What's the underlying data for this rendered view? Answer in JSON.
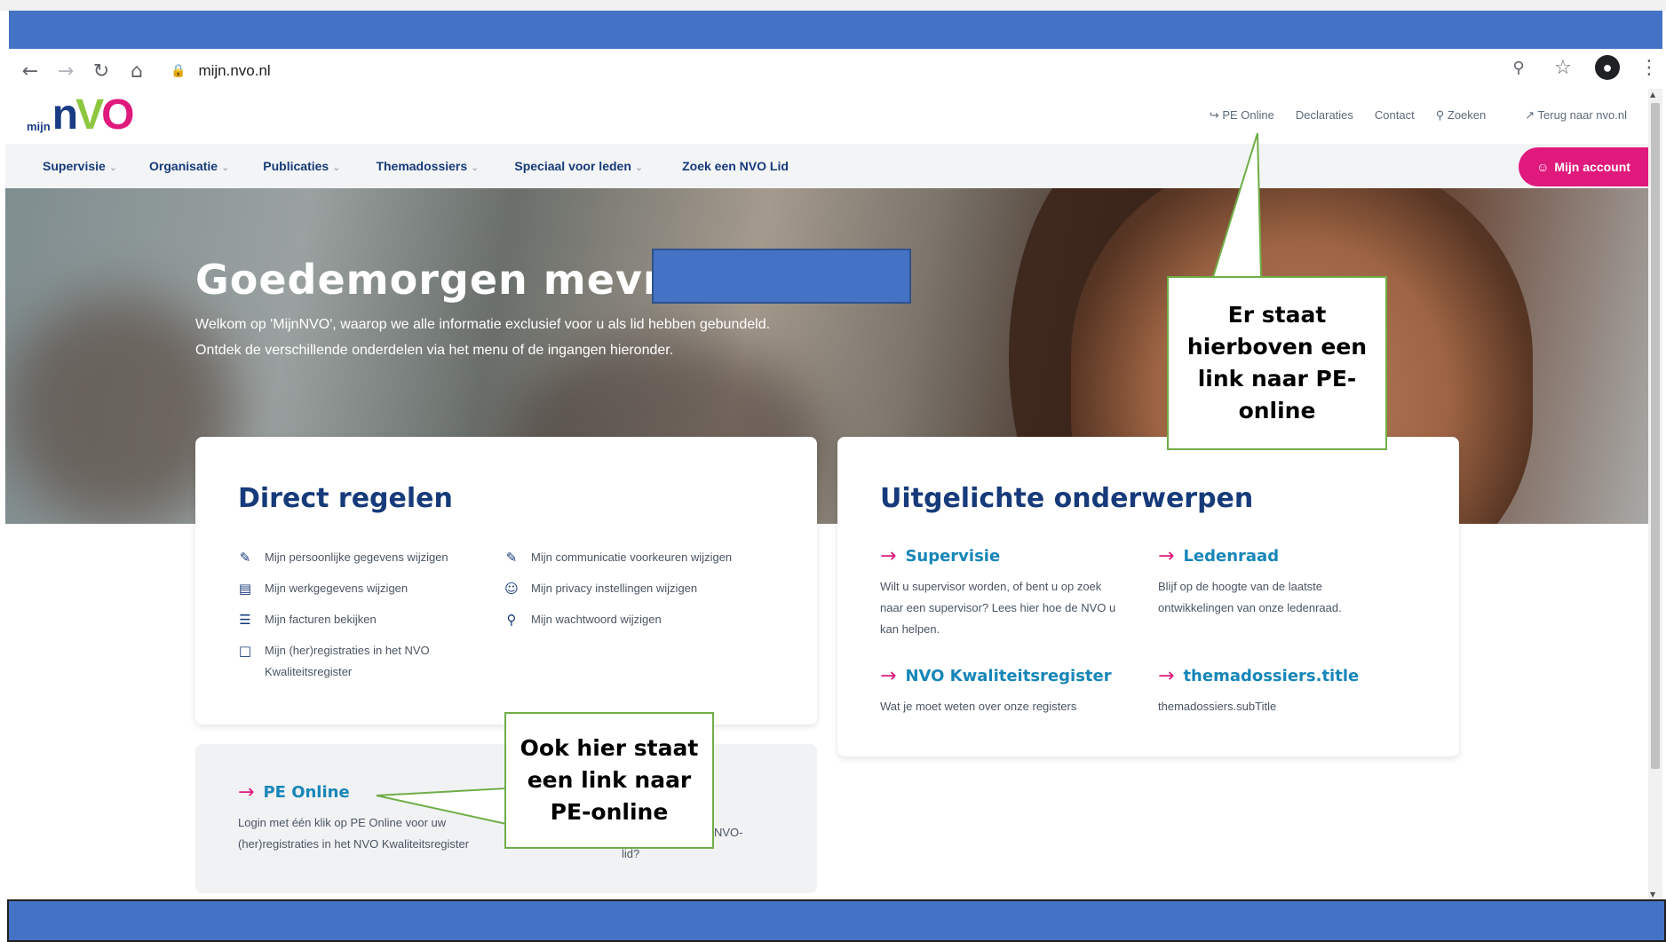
{
  "colors": {
    "annotation_blue": "#4472c4",
    "brand_navy": "#163a7a",
    "brand_pink": "#e0197d",
    "brand_green": "#8dc63f",
    "callout_border": "#70ad47",
    "link_blue": "#1786b8"
  },
  "browser": {
    "url": "mijn.nvo.nl",
    "icons": {
      "back": "arrow-left-icon",
      "forward": "arrow-right-icon",
      "reload": "reload-icon",
      "home": "home-icon",
      "lock": "lock-icon",
      "zoom": "zoom-icon",
      "bookmark": "star-icon",
      "profile": "profile-icon",
      "menu": "kebab-menu-icon"
    }
  },
  "logo": {
    "small": "mijn",
    "n": "n",
    "v": "V",
    "o": "O"
  },
  "utility_nav": [
    {
      "label": "PE Online",
      "icon": "login-icon"
    },
    {
      "label": "Declaraties"
    },
    {
      "label": "Contact"
    },
    {
      "label": "Zoeken",
      "icon": "search-icon"
    },
    {
      "label": "Terug naar nvo.nl",
      "icon": "external-link-icon"
    }
  ],
  "main_nav": [
    {
      "label": "Supervisie",
      "dropdown": true
    },
    {
      "label": "Organisatie",
      "dropdown": true
    },
    {
      "label": "Publicaties",
      "dropdown": true
    },
    {
      "label": "Themadossiers",
      "dropdown": true
    },
    {
      "label": "Speciaal voor leden",
      "dropdown": true
    },
    {
      "label": "Zoek een NVO Lid",
      "dropdown": false
    }
  ],
  "account_button": "Mijn account",
  "hero": {
    "title": "Goedemorgen mevrouw",
    "line1": "Welkom op 'MijnNVO', waarop we alle informatie exclusief voor u als lid hebben gebundeld.",
    "line2": "Ontdek de verschillende onderdelen via het menu of de ingangen hieronder."
  },
  "direct_regelen": {
    "title": "Direct regelen",
    "items": [
      {
        "label": "Mijn persoonlijke gegevens wijzigen",
        "icon": "user-edit-icon"
      },
      {
        "label": "Mijn werkgegevens wijzigen",
        "icon": "briefcase-icon"
      },
      {
        "label": "Mijn facturen bekijken",
        "icon": "invoice-icon"
      },
      {
        "label": "Mijn (her)registraties in het NVO",
        "label2": "Kwaliteitsregister",
        "icon": "certificate-icon"
      },
      {
        "label": "Mijn communicatie voorkeuren wijzigen",
        "icon": "message-edit-icon"
      },
      {
        "label": "Mijn privacy instellingen wijzigen",
        "icon": "user-lock-icon"
      },
      {
        "label": "Mijn wachtwoord wijzigen",
        "icon": "key-icon"
      }
    ]
  },
  "pe_online": {
    "title": "PE Online",
    "line1": "Login met één klik op PE Online voor uw",
    "line2": "(her)registraties in het NVO Kwaliteitsregister",
    "fragment1": "r NVO-",
    "fragment2": "lid?"
  },
  "uitgelicht": {
    "title": "Uitgelichte onderwerpen",
    "topics": [
      {
        "title": "Supervisie",
        "lines": [
          "Wilt u supervisor worden, of bent u op zoek",
          "naar een supervisor? Lees hier hoe de NVO u",
          "kan helpen."
        ]
      },
      {
        "title": "Ledenraad",
        "lines": [
          "Blijf op de hoogte van de laatste",
          "ontwikkelingen van onze ledenraad."
        ]
      },
      {
        "title": "NVO Kwaliteitsregister",
        "lines": [
          "Wat je moet weten over onze registers"
        ]
      },
      {
        "title": "themadossiers.title",
        "lines": [
          "themadossiers.subTitle"
        ]
      }
    ]
  },
  "callouts": {
    "top": [
      "Er staat",
      "hierboven een",
      "link naar PE-",
      "online"
    ],
    "bottom": [
      "Ook hier staat",
      "een link naar",
      "PE-online"
    ]
  }
}
